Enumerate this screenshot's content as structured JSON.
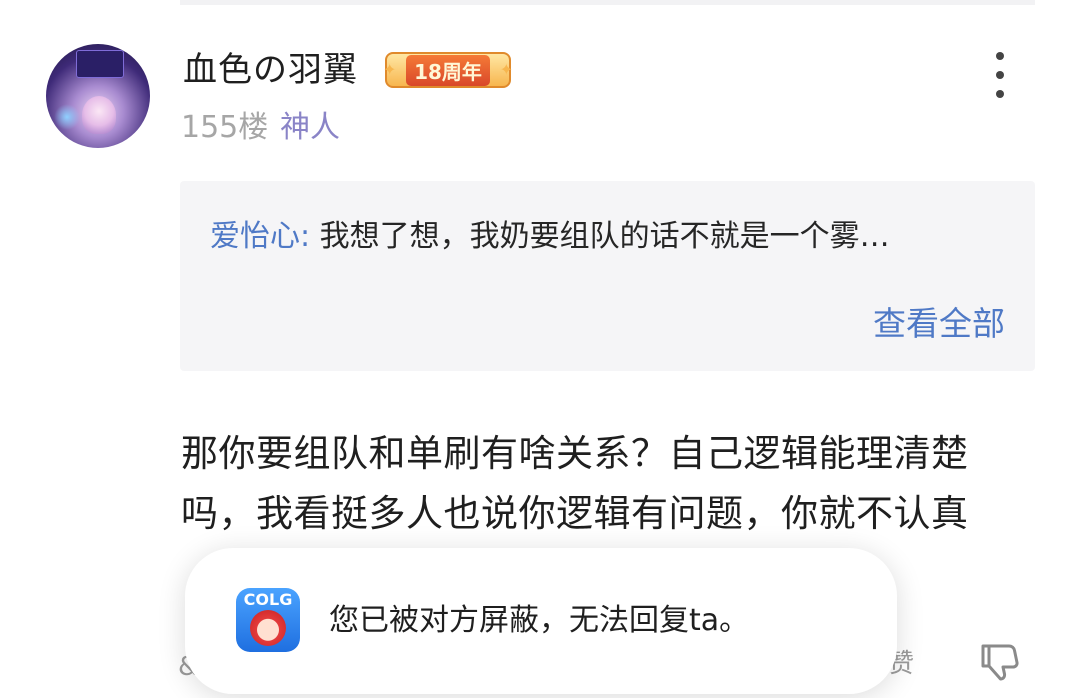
{
  "post": {
    "username": "血色の羽翼",
    "badge": "18周年",
    "floor": "155楼",
    "level": "神人"
  },
  "quote": {
    "author": "爱怡心:",
    "text": "我想了想，我奶要组队的话不就是一个雾…",
    "view_all": "查看全部"
  },
  "body": {
    "line1": "那你要组队和单刷有啥关系？自己逻辑能理清楚",
    "line2": "吗，我看挺多人也说你逻辑有问题，你就不认真"
  },
  "toast": {
    "app_logo_text": "COLG",
    "message": "您已被对方屏蔽，无法回复ta。"
  },
  "actions": {
    "like_partial": "赞"
  },
  "icons": {
    "more": "more-vertical-icon",
    "dislike": "thumb-down-icon"
  }
}
